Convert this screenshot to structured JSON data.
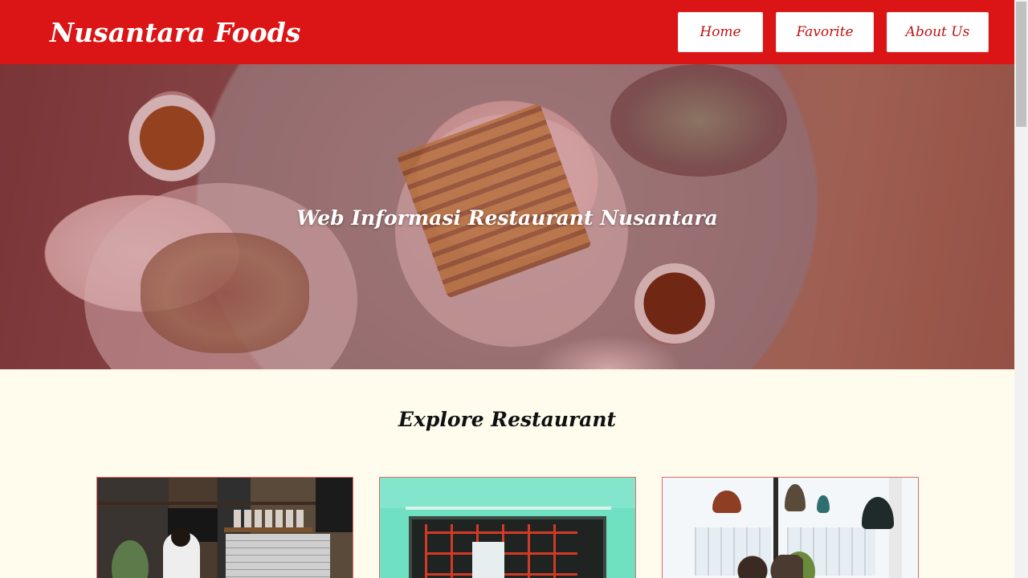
{
  "header": {
    "brand": "Nusantara Foods",
    "nav": [
      {
        "label": "Home"
      },
      {
        "label": "Favorite"
      },
      {
        "label": "About Us"
      }
    ]
  },
  "hero": {
    "title": "Web Informasi Restaurant Nusantara"
  },
  "explore": {
    "title": "Explore Restaurant"
  },
  "colors": {
    "header_bg": "#db1515",
    "page_bg": "#fffcee",
    "nav_text": "#c01313",
    "card_border": "#e36a6a"
  }
}
